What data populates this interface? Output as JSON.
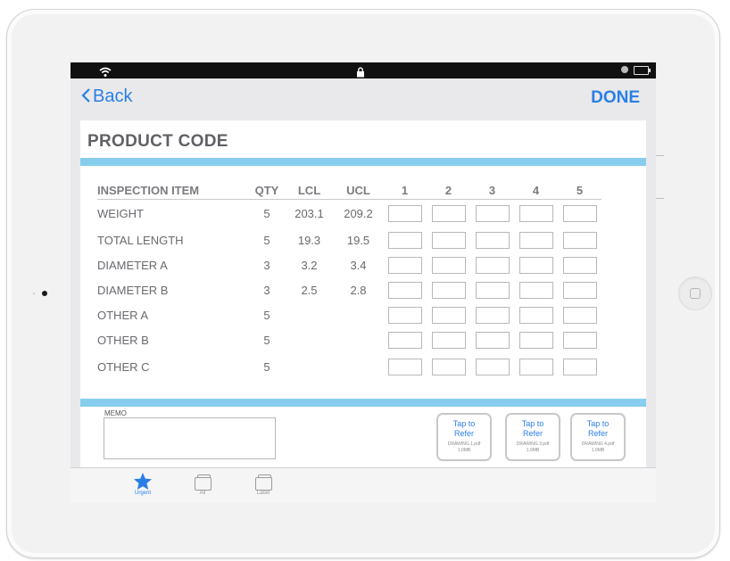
{
  "navbar": {
    "back_label": "Back",
    "done_label": "DONE"
  },
  "page": {
    "title": "PRODUCT CODE"
  },
  "table": {
    "headers": [
      "INSPECTION ITEM",
      "QTY",
      "LCL",
      "UCL",
      "1",
      "2",
      "3",
      "4",
      "5"
    ],
    "rows": [
      {
        "item": "WEIGHT",
        "qty": "5",
        "lcl": "203.1",
        "ucl": "209.2"
      },
      {
        "item": "TOTAL LENGTH",
        "qty": "5",
        "lcl": "19.3",
        "ucl": "19.5"
      },
      {
        "item": "DIAMETER A",
        "qty": "3",
        "lcl": "3.2",
        "ucl": "3.4"
      },
      {
        "item": "DIAMETER B",
        "qty": "3",
        "lcl": "2.5",
        "ucl": "2.8"
      },
      {
        "item": "OTHER A",
        "qty": "5",
        "lcl": "",
        "ucl": ""
      },
      {
        "item": "OTHER B",
        "qty": "5",
        "lcl": "",
        "ucl": ""
      },
      {
        "item": "OTHER C",
        "qty": "5",
        "lcl": "",
        "ucl": ""
      }
    ]
  },
  "memo": {
    "label": "MEMO",
    "value": ""
  },
  "refer_buttons": [
    {
      "label_1": "Tap to",
      "label_2": "Refer",
      "file": "DRAWING 1.pdf",
      "size": "1.0MB"
    },
    {
      "label_1": "Tap to",
      "label_2": "Refer",
      "file": "DRAWING 3.pdf",
      "size": "1.0MB"
    },
    {
      "label_1": "Tap to",
      "label_2": "Refer",
      "file": "DRAWING 4.pdf",
      "size": "1.0MB"
    }
  ],
  "tabbar": {
    "items": [
      {
        "label": "Urgent",
        "icon": "star-icon",
        "active": true
      },
      {
        "label": "All",
        "icon": "folder-icon",
        "active": false
      },
      {
        "label": "Label",
        "icon": "folder-icon",
        "active": false
      }
    ]
  },
  "colors": {
    "accent": "#2a7fe6",
    "band": "#87cdee",
    "title": "#606066"
  }
}
